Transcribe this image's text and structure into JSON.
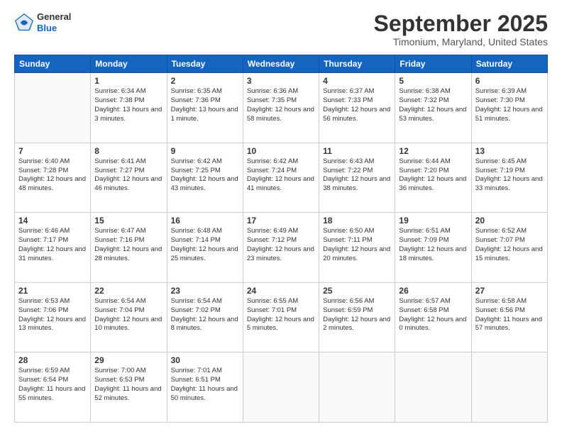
{
  "logo": {
    "general": "General",
    "blue": "Blue"
  },
  "header": {
    "month": "September 2025",
    "location": "Timonium, Maryland, United States"
  },
  "days_of_week": [
    "Sunday",
    "Monday",
    "Tuesday",
    "Wednesday",
    "Thursday",
    "Friday",
    "Saturday"
  ],
  "weeks": [
    [
      {
        "day": "",
        "empty": true
      },
      {
        "day": "1",
        "sunrise": "Sunrise: 6:34 AM",
        "sunset": "Sunset: 7:38 PM",
        "daylight": "Daylight: 13 hours and 3 minutes."
      },
      {
        "day": "2",
        "sunrise": "Sunrise: 6:35 AM",
        "sunset": "Sunset: 7:36 PM",
        "daylight": "Daylight: 13 hours and 1 minute."
      },
      {
        "day": "3",
        "sunrise": "Sunrise: 6:36 AM",
        "sunset": "Sunset: 7:35 PM",
        "daylight": "Daylight: 12 hours and 58 minutes."
      },
      {
        "day": "4",
        "sunrise": "Sunrise: 6:37 AM",
        "sunset": "Sunset: 7:33 PM",
        "daylight": "Daylight: 12 hours and 56 minutes."
      },
      {
        "day": "5",
        "sunrise": "Sunrise: 6:38 AM",
        "sunset": "Sunset: 7:32 PM",
        "daylight": "Daylight: 12 hours and 53 minutes."
      },
      {
        "day": "6",
        "sunrise": "Sunrise: 6:39 AM",
        "sunset": "Sunset: 7:30 PM",
        "daylight": "Daylight: 12 hours and 51 minutes."
      }
    ],
    [
      {
        "day": "7",
        "sunrise": "Sunrise: 6:40 AM",
        "sunset": "Sunset: 7:28 PM",
        "daylight": "Daylight: 12 hours and 48 minutes."
      },
      {
        "day": "8",
        "sunrise": "Sunrise: 6:41 AM",
        "sunset": "Sunset: 7:27 PM",
        "daylight": "Daylight: 12 hours and 46 minutes."
      },
      {
        "day": "9",
        "sunrise": "Sunrise: 6:42 AM",
        "sunset": "Sunset: 7:25 PM",
        "daylight": "Daylight: 12 hours and 43 minutes."
      },
      {
        "day": "10",
        "sunrise": "Sunrise: 6:42 AM",
        "sunset": "Sunset: 7:24 PM",
        "daylight": "Daylight: 12 hours and 41 minutes."
      },
      {
        "day": "11",
        "sunrise": "Sunrise: 6:43 AM",
        "sunset": "Sunset: 7:22 PM",
        "daylight": "Daylight: 12 hours and 38 minutes."
      },
      {
        "day": "12",
        "sunrise": "Sunrise: 6:44 AM",
        "sunset": "Sunset: 7:20 PM",
        "daylight": "Daylight: 12 hours and 36 minutes."
      },
      {
        "day": "13",
        "sunrise": "Sunrise: 6:45 AM",
        "sunset": "Sunset: 7:19 PM",
        "daylight": "Daylight: 12 hours and 33 minutes."
      }
    ],
    [
      {
        "day": "14",
        "sunrise": "Sunrise: 6:46 AM",
        "sunset": "Sunset: 7:17 PM",
        "daylight": "Daylight: 12 hours and 31 minutes."
      },
      {
        "day": "15",
        "sunrise": "Sunrise: 6:47 AM",
        "sunset": "Sunset: 7:16 PM",
        "daylight": "Daylight: 12 hours and 28 minutes."
      },
      {
        "day": "16",
        "sunrise": "Sunrise: 6:48 AM",
        "sunset": "Sunset: 7:14 PM",
        "daylight": "Daylight: 12 hours and 25 minutes."
      },
      {
        "day": "17",
        "sunrise": "Sunrise: 6:49 AM",
        "sunset": "Sunset: 7:12 PM",
        "daylight": "Daylight: 12 hours and 23 minutes."
      },
      {
        "day": "18",
        "sunrise": "Sunrise: 6:50 AM",
        "sunset": "Sunset: 7:11 PM",
        "daylight": "Daylight: 12 hours and 20 minutes."
      },
      {
        "day": "19",
        "sunrise": "Sunrise: 6:51 AM",
        "sunset": "Sunset: 7:09 PM",
        "daylight": "Daylight: 12 hours and 18 minutes."
      },
      {
        "day": "20",
        "sunrise": "Sunrise: 6:52 AM",
        "sunset": "Sunset: 7:07 PM",
        "daylight": "Daylight: 12 hours and 15 minutes."
      }
    ],
    [
      {
        "day": "21",
        "sunrise": "Sunrise: 6:53 AM",
        "sunset": "Sunset: 7:06 PM",
        "daylight": "Daylight: 12 hours and 13 minutes."
      },
      {
        "day": "22",
        "sunrise": "Sunrise: 6:54 AM",
        "sunset": "Sunset: 7:04 PM",
        "daylight": "Daylight: 12 hours and 10 minutes."
      },
      {
        "day": "23",
        "sunrise": "Sunrise: 6:54 AM",
        "sunset": "Sunset: 7:02 PM",
        "daylight": "Daylight: 12 hours and 8 minutes."
      },
      {
        "day": "24",
        "sunrise": "Sunrise: 6:55 AM",
        "sunset": "Sunset: 7:01 PM",
        "daylight": "Daylight: 12 hours and 5 minutes."
      },
      {
        "day": "25",
        "sunrise": "Sunrise: 6:56 AM",
        "sunset": "Sunset: 6:59 PM",
        "daylight": "Daylight: 12 hours and 2 minutes."
      },
      {
        "day": "26",
        "sunrise": "Sunrise: 6:57 AM",
        "sunset": "Sunset: 6:58 PM",
        "daylight": "Daylight: 12 hours and 0 minutes."
      },
      {
        "day": "27",
        "sunrise": "Sunrise: 6:58 AM",
        "sunset": "Sunset: 6:56 PM",
        "daylight": "Daylight: 11 hours and 57 minutes."
      }
    ],
    [
      {
        "day": "28",
        "sunrise": "Sunrise: 6:59 AM",
        "sunset": "Sunset: 6:54 PM",
        "daylight": "Daylight: 11 hours and 55 minutes."
      },
      {
        "day": "29",
        "sunrise": "Sunrise: 7:00 AM",
        "sunset": "Sunset: 6:53 PM",
        "daylight": "Daylight: 11 hours and 52 minutes."
      },
      {
        "day": "30",
        "sunrise": "Sunrise: 7:01 AM",
        "sunset": "Sunset: 6:51 PM",
        "daylight": "Daylight: 11 hours and 50 minutes."
      },
      {
        "day": "",
        "empty": true
      },
      {
        "day": "",
        "empty": true
      },
      {
        "day": "",
        "empty": true
      },
      {
        "day": "",
        "empty": true
      }
    ]
  ]
}
